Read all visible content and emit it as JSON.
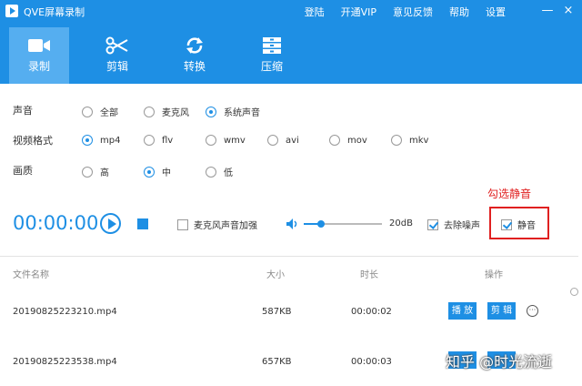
{
  "app": {
    "title": "QVE屏幕录制"
  },
  "top_menu": [
    "登陆",
    "开通VIP",
    "意见反馈",
    "帮助",
    "设置"
  ],
  "window_controls": {
    "minimize": "—",
    "close": "×"
  },
  "tabs": [
    {
      "label": "录制",
      "icon": "video-camera-icon",
      "active": true
    },
    {
      "label": "剪辑",
      "icon": "scissors-icon",
      "active": false
    },
    {
      "label": "转换",
      "icon": "refresh-icon",
      "active": false
    },
    {
      "label": "压缩",
      "icon": "archive-icon",
      "active": false
    }
  ],
  "settings": {
    "audio": {
      "label": "声音",
      "options": [
        "全部",
        "麦克风",
        "系统声音"
      ],
      "selected": "系统声音"
    },
    "format": {
      "label": "视频格式",
      "options": [
        "mp4",
        "flv",
        "wmv",
        "avi",
        "mov",
        "mkv"
      ],
      "selected": "mp4"
    },
    "quality": {
      "label": "画质",
      "options": [
        "高",
        "中",
        "低"
      ],
      "selected": "中"
    }
  },
  "annotation": {
    "hint": "勾选静音"
  },
  "recorder": {
    "timer": "00:00:00",
    "mic_boost_label": "麦克风声音加强",
    "mic_boost_checked": false,
    "volume_level": 0.22,
    "volume_db": "20dB",
    "denoise_label": "去除噪声",
    "denoise_checked": true,
    "mute_label": "静音",
    "mute_checked": true
  },
  "file_table": {
    "columns": [
      "文件名称",
      "大小",
      "时长",
      "操作"
    ],
    "rows": [
      {
        "name": "20190825223210.mp4",
        "size": "587KB",
        "duration": "00:00:02"
      },
      {
        "name": "20190825223538.mp4",
        "size": "657KB",
        "duration": "00:00:03"
      }
    ],
    "play_label": "播 放",
    "edit_label": "剪 辑",
    "more_label": "···"
  },
  "watermark": "知乎 @时光流逝",
  "colors": {
    "accent": "#1e8fe4",
    "active_tab": "#55aef0",
    "annotation": "#e02020"
  }
}
